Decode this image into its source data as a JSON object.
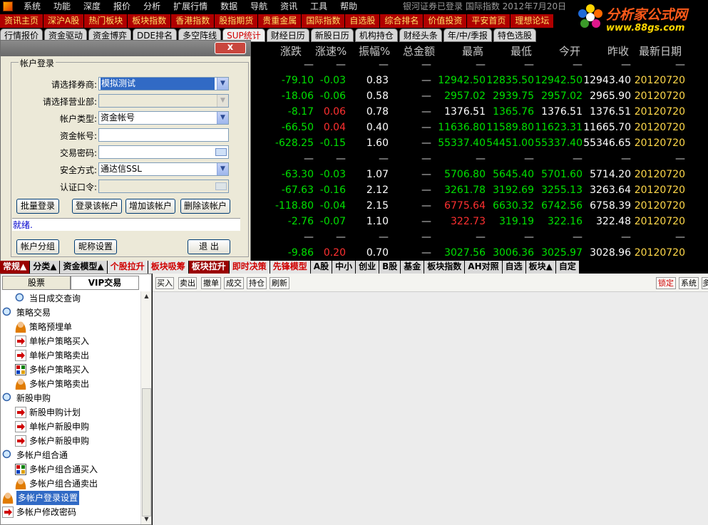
{
  "menu": {
    "items": [
      "系统",
      "功能",
      "深度",
      "报价",
      "分析",
      "扩展行情",
      "数据",
      "导航",
      "资讯",
      "工具",
      "帮助"
    ],
    "status_text": "银河证券已登录   国际指数  2012年7月20日"
  },
  "logo": {
    "title": "分析家公式网",
    "url": "www.88gs.com"
  },
  "red_nav": [
    "资讯主页",
    "深沪A股",
    "热门板块",
    "板块指数",
    "香港指数",
    "股指期货",
    "贵重金属",
    "国际指数",
    "自选股",
    "综合排名",
    "价值投资",
    "平安首页",
    "理想论坛"
  ],
  "tabs": [
    {
      "label": "行情报价",
      "selected": false
    },
    {
      "label": "资金驱动",
      "selected": false
    },
    {
      "label": "资金博弈",
      "selected": false
    },
    {
      "label": "DDE排名",
      "selected": false
    },
    {
      "label": "多空阵线",
      "selected": false
    },
    {
      "label": "SUP统计",
      "selected": true
    },
    {
      "label": "财经日历",
      "selected": false
    },
    {
      "label": "新股日历",
      "selected": false
    },
    {
      "label": "机构持仓",
      "selected": false
    },
    {
      "label": "财经头条",
      "selected": false
    },
    {
      "label": "年/中/季报",
      "selected": false
    },
    {
      "label": "特色选股",
      "selected": false
    }
  ],
  "quote_table": {
    "headers": [
      "涨跌",
      "涨速%",
      "振幅%",
      "总金额",
      "最高",
      "最低",
      "今开",
      "昨收",
      "最新日期"
    ],
    "rows": [
      {
        "chg": "—",
        "spd": "—",
        "amp": "—",
        "amt": "—",
        "high": "—",
        "low": "—",
        "open": "—",
        "prev": "—",
        "date": "—",
        "blank": true
      },
      {
        "chg": "-79.10",
        "spd": "-0.03",
        "amp": "0.83",
        "amt": "—",
        "high": "12942.50",
        "low": "12835.50",
        "open": "12942.50",
        "prev": "12943.40",
        "date": "20120720"
      },
      {
        "chg": "-18.06",
        "spd": "-0.06",
        "amp": "0.58",
        "amt": "—",
        "high": "2957.02",
        "low": "2939.75",
        "open": "2957.02",
        "prev": "2965.90",
        "date": "20120720"
      },
      {
        "chg": "-8.17",
        "spd": "0.06",
        "amp": "0.78",
        "amt": "—",
        "high": "1376.51",
        "low": "1365.76",
        "open": "1376.51",
        "prev": "1376.51",
        "date": "20120720"
      },
      {
        "chg": "-66.50",
        "spd": "0.04",
        "amp": "0.40",
        "amt": "—",
        "high": "11636.80",
        "low": "11589.80",
        "open": "11623.31",
        "prev": "11665.70",
        "date": "20120720"
      },
      {
        "chg": "-628.25",
        "spd": "-0.15",
        "amp": "1.60",
        "amt": "—",
        "high": "55337.40",
        "low": "54451.00",
        "open": "55337.40",
        "prev": "55346.65",
        "date": "20120720"
      },
      {
        "chg": "—",
        "spd": "—",
        "amp": "—",
        "amt": "—",
        "high": "—",
        "low": "—",
        "open": "—",
        "prev": "—",
        "date": "—",
        "blank": true
      },
      {
        "chg": "-63.30",
        "spd": "-0.03",
        "amp": "1.07",
        "amt": "—",
        "high": "5706.80",
        "low": "5645.40",
        "open": "5701.60",
        "prev": "5714.20",
        "date": "20120720"
      },
      {
        "chg": "-67.63",
        "spd": "-0.16",
        "amp": "2.12",
        "amt": "—",
        "high": "3261.78",
        "low": "3192.69",
        "open": "3255.13",
        "prev": "3263.64",
        "date": "20120720"
      },
      {
        "chg": "-118.80",
        "spd": "-0.04",
        "amp": "2.15",
        "amt": "—",
        "high": "6775.64",
        "low": "6630.32",
        "open": "6742.56",
        "prev": "6758.39",
        "date": "20120720"
      },
      {
        "chg": "-2.76",
        "spd": "-0.07",
        "amp": "1.10",
        "amt": "—",
        "high": "322.73",
        "low": "319.19",
        "open": "322.16",
        "prev": "322.48",
        "date": "20120720"
      },
      {
        "chg": "—",
        "spd": "—",
        "amp": "—",
        "amt": "—",
        "high": "—",
        "low": "—",
        "open": "—",
        "prev": "—",
        "date": "—",
        "blank": true
      },
      {
        "chg": "-9.86",
        "spd": "0.20",
        "amp": "0.70",
        "amt": "—",
        "high": "3027.56",
        "low": "3006.36",
        "open": "3025.97",
        "prev": "3028.96",
        "date": "20120720"
      }
    ]
  },
  "login_dialog": {
    "close_label": "x",
    "group_title": "帐户登录",
    "fields": [
      {
        "label": "请选择券商:",
        "value": "模拟测试"
      },
      {
        "label": "请选择营业部:",
        "value": ""
      },
      {
        "label": "帐户类型:",
        "value": "资金帐号"
      },
      {
        "label": "资金帐号:",
        "value": ""
      },
      {
        "label": "交易密码:",
        "value": ""
      },
      {
        "label": "安全方式:",
        "value": "通达信SSL"
      },
      {
        "label": "认证口令:",
        "value": ""
      }
    ],
    "buttons": [
      "批量登录",
      "登录该帐户",
      "增加该帐户",
      "删除该帐户"
    ],
    "status": "就绪.",
    "bottom_buttons": [
      "帐户分组",
      "昵称设置",
      "退 出"
    ]
  },
  "bottom_tabs": [
    "常规▲",
    "分类▲",
    "资金模型▲",
    "个股拉升",
    "板块吸筹",
    "板块拉升",
    "即时决策",
    "先锋模型",
    "A股",
    "中小",
    "创业",
    "B股",
    "基金",
    "板块指数",
    "AH对照",
    "自选",
    "板块▲",
    "自定"
  ],
  "left_panel": {
    "tabs": [
      "股票",
      "VIP交易"
    ],
    "tree": [
      {
        "label": "当日成交查询",
        "icon": "magnifier-icon",
        "level": 1
      },
      {
        "label": "策略交易",
        "icon": "magnifier-icon",
        "level": 0
      },
      {
        "label": "策略预埋单",
        "icon": "person-icon",
        "level": 1
      },
      {
        "label": "单帐户策略买入",
        "icon": "red-arrow-icon",
        "level": 1
      },
      {
        "label": "单帐户策略卖出",
        "icon": "red-arrow-icon",
        "level": 1
      },
      {
        "label": "多帐户策略买入",
        "icon": "grid-icon",
        "level": 1
      },
      {
        "label": "多帐户策略卖出",
        "icon": "person-icon",
        "level": 1
      },
      {
        "label": "新股申购",
        "icon": "magnifier-icon",
        "level": 0
      },
      {
        "label": "新股申购计划",
        "icon": "red-arrow-icon",
        "level": 1
      },
      {
        "label": "单帐户新股申购",
        "icon": "red-arrow-icon",
        "level": 1
      },
      {
        "label": "多帐户新股申购",
        "icon": "red-arrow-icon",
        "level": 1
      },
      {
        "label": "多帐户组合通",
        "icon": "magnifier-icon",
        "level": 0
      },
      {
        "label": "多帐户组合通买入",
        "icon": "grid-icon",
        "level": 1
      },
      {
        "label": "多帐户组合通卖出",
        "icon": "person-icon",
        "level": 1
      },
      {
        "label": "多帐户登录设置",
        "icon": "person-icon",
        "level": 0,
        "selected": true
      },
      {
        "label": "多帐户修改密码",
        "icon": "red-arrow-icon",
        "level": 0
      }
    ]
  },
  "trade_toolbar": {
    "left": [
      "买入",
      "卖出",
      "撤单",
      "成交",
      "持仓",
      "刷新"
    ],
    "right": [
      "锁定",
      "系统",
      "多"
    ]
  },
  "colors": {
    "up": "#ff3030",
    "down": "#00e000",
    "date": "#ffd84a",
    "nav_bg": "#b00000",
    "nav_text": "#ffe066"
  }
}
